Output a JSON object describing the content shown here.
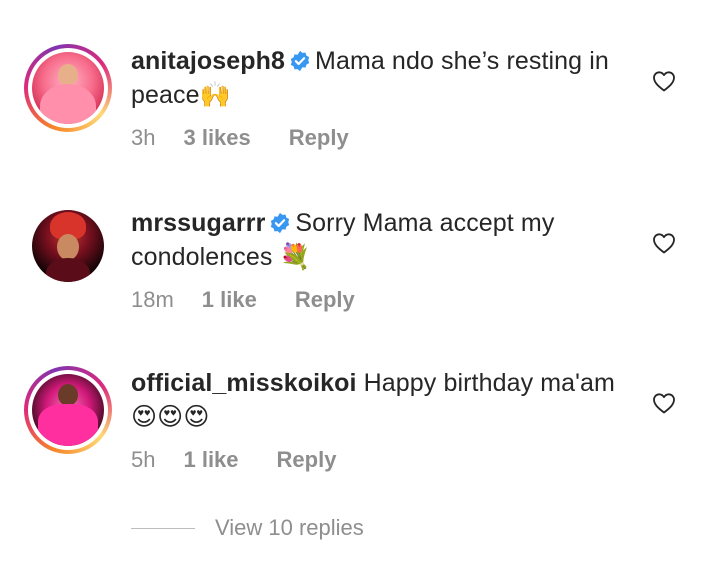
{
  "comments": [
    {
      "username": "anitajoseph8",
      "verified": true,
      "text": "Mama ndo she’s resting in peace🙌",
      "time": "3h",
      "likes": "3 likes",
      "reply": "Reply",
      "avatar_story_ring": true
    },
    {
      "username": "mrssugarrr",
      "verified": true,
      "text": "Sorry Mama accept my condolences 💐",
      "time": "18m",
      "likes": "1 like",
      "reply": "Reply",
      "avatar_story_ring": false
    },
    {
      "username": "official_misskoikoi",
      "verified": false,
      "text": "Happy birthday ma'am 😍😍😍",
      "time": "5h",
      "likes": "1 like",
      "reply": "Reply",
      "avatar_story_ring": true
    }
  ],
  "view_replies": "View 10 replies",
  "icons": {
    "like": "heart-outline-icon",
    "verified": "verified-badge-icon"
  },
  "colors": {
    "text": "#262626",
    "secondary": "#8e8e8e",
    "verified": "#3897f0"
  }
}
